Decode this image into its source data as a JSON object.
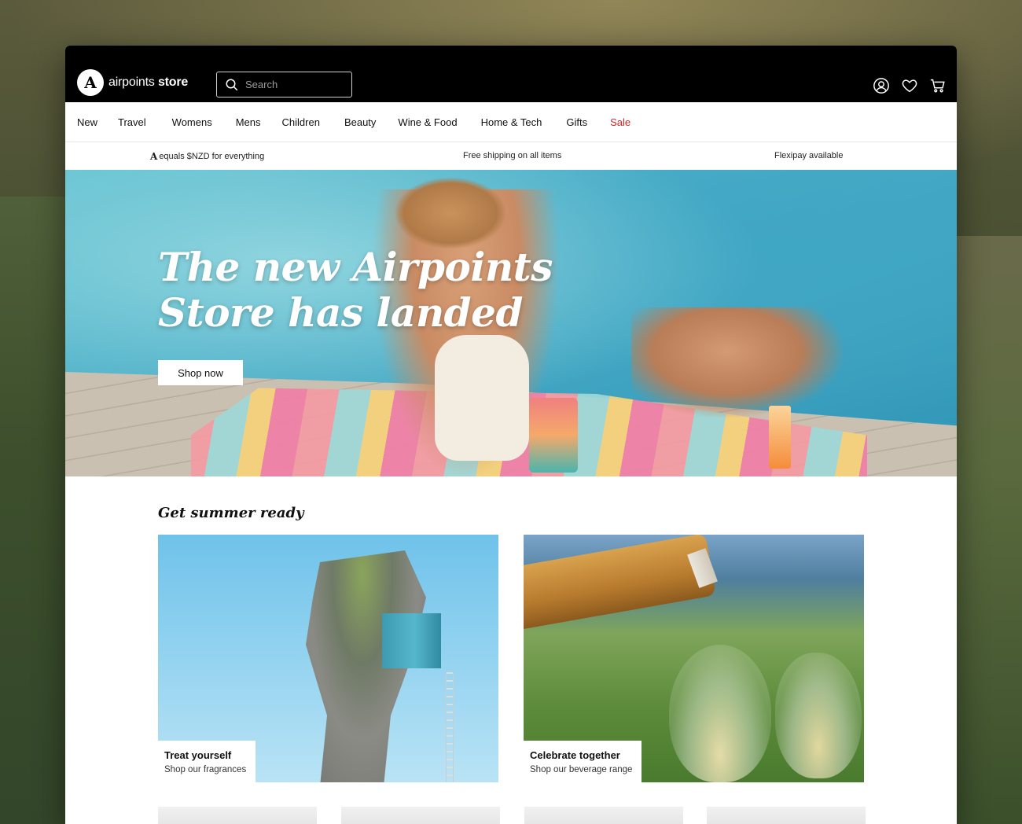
{
  "brand": {
    "logo_mark": "A",
    "name_light": "airpoints",
    "name_bold": "store"
  },
  "search": {
    "placeholder": "Search"
  },
  "icons": {
    "search": "search-icon",
    "account": "user-icon",
    "wishlist": "heart-icon",
    "cart": "cart-icon"
  },
  "nav": {
    "items": [
      {
        "label": "New"
      },
      {
        "label": "Travel"
      },
      {
        "label": "Womens"
      },
      {
        "label": "Mens"
      },
      {
        "label": "Children"
      },
      {
        "label": "Beauty"
      },
      {
        "label": "Wine & Food"
      },
      {
        "label": "Home & Tech"
      },
      {
        "label": "Gifts"
      },
      {
        "label": "Sale"
      }
    ],
    "sale_color": "#e0201f"
  },
  "infobar": {
    "points_mark": "A",
    "points_text": "equals $NZD for everything",
    "shipping": "Free shipping on all items",
    "flexipay": "Flexipay available"
  },
  "hero": {
    "headline_line1": "The new Airpoints",
    "headline_line2": "Store has landed",
    "cta": "Shop now"
  },
  "section": {
    "title": "Get summer ready"
  },
  "cards": [
    {
      "title": "Treat yourself",
      "subtitle": "Shop our fragrances"
    },
    {
      "title": "Celebrate together",
      "subtitle": "Shop our beverage range"
    }
  ]
}
